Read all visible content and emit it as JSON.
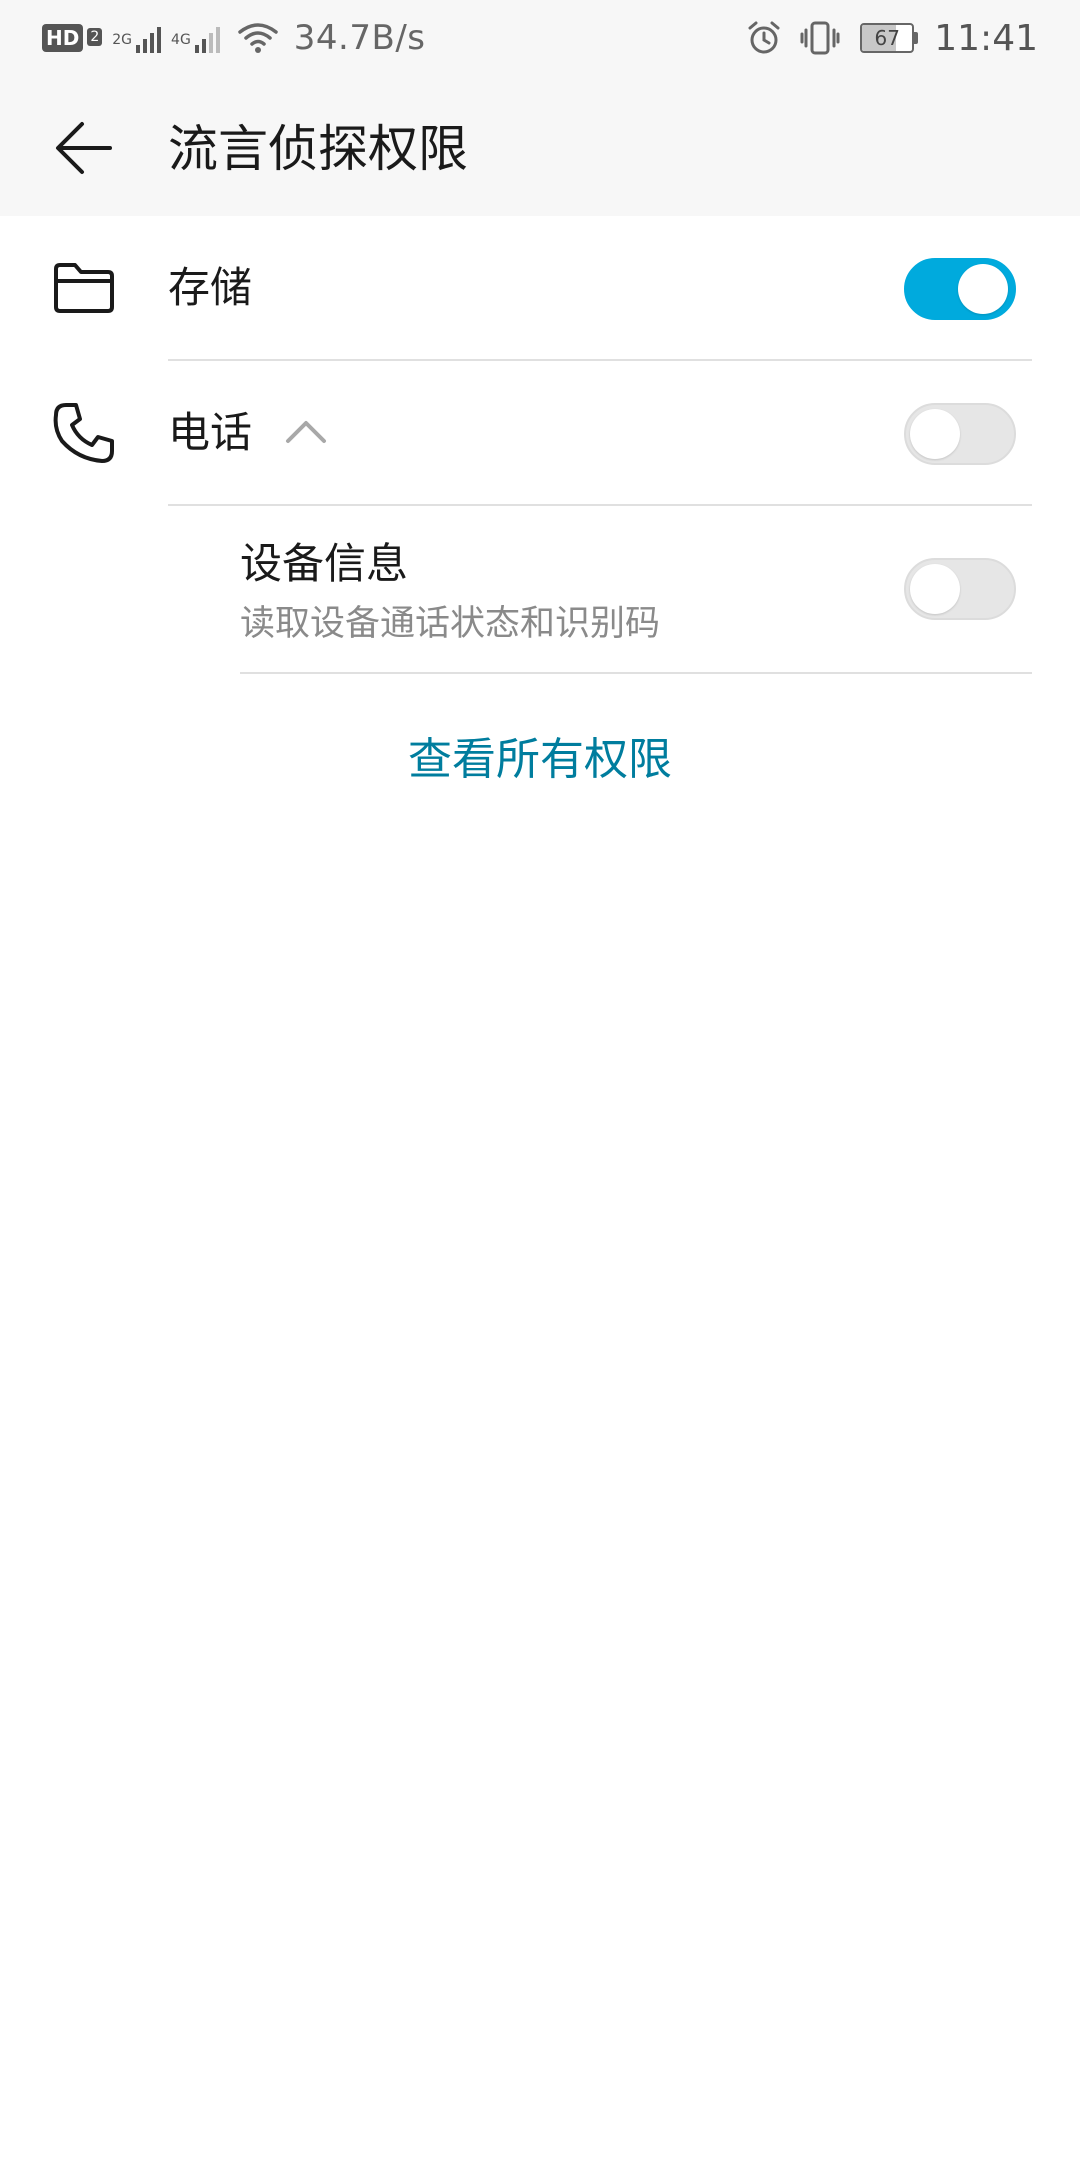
{
  "status_bar": {
    "hd_label": "HD",
    "sim_number": "2",
    "network_1": "2G",
    "network_2": "4G",
    "speed": "34.7B/s",
    "battery_level": "67",
    "battery_percent": 67,
    "time": "11:41",
    "icons": [
      "alarm-icon",
      "vibrate-icon",
      "wifi-icon"
    ]
  },
  "header": {
    "title": "流言侦探权限",
    "back_icon": "arrow-left-icon"
  },
  "permissions": [
    {
      "label": "存储",
      "icon": "folder-icon",
      "enabled": true
    },
    {
      "label": "电话",
      "icon": "phone-icon",
      "expanded": true,
      "enabled": false,
      "children": [
        {
          "label": "设备信息",
          "description": "读取设备通话状态和识别码",
          "enabled": false
        }
      ]
    }
  ],
  "footer_link": "查看所有权限",
  "colors": {
    "accent": "#00aadd",
    "link": "#007d9e",
    "header_bg": "#f7f7f7",
    "divider": "#e0e0e0"
  }
}
